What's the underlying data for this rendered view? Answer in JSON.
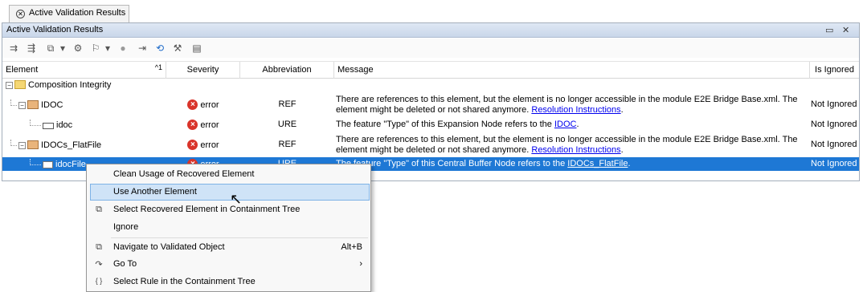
{
  "tab": {
    "label": "Active Validation Results"
  },
  "panel": {
    "title": "Active Validation Results",
    "restore_glyph": "▭",
    "close_glyph": "✕"
  },
  "toolbar": {
    "icons": [
      "⇉",
      "⇶",
      "⧉",
      "▾",
      "⚙",
      "⚐",
      "▾",
      "●",
      "⇥",
      "⟲",
      "⚒",
      "▤"
    ]
  },
  "table": {
    "headers": {
      "element": "Element",
      "sort": "^1",
      "severity": "Severity",
      "abbreviation": "Abbreviation",
      "message": "Message",
      "ignored": "Is Ignored"
    },
    "group": {
      "label": "Composition Integrity"
    },
    "rows": [
      {
        "element": "IDOC",
        "severity": "error",
        "abbr": "REF",
        "msg1": "There are references to this element, but the element is no longer accessible in the module E2E Bridge Base.xml. The",
        "msg2": "element might be deleted or not shared anymore. ",
        "link": "Resolution Instructions",
        "tail": ".",
        "ignored": "Not Ignored"
      },
      {
        "element": "idoc",
        "severity": "error",
        "abbr": "URE",
        "msg1": "The feature \"Type\" of this Expansion Node refers to the ",
        "link": "IDOC",
        "tail": ".",
        "ignored": "Not Ignored"
      },
      {
        "element": "IDOCs_FlatFile",
        "severity": "error",
        "abbr": "REF",
        "msg1": "There are references to this element, but the element is no longer accessible in the module E2E Bridge Base.xml. The",
        "msg2": "element might be deleted or not shared anymore. ",
        "link": "Resolution Instructions",
        "tail": ".",
        "ignored": "Not Ignored"
      },
      {
        "element": "idocFile",
        "severity": "error",
        "abbr": "URE",
        "msg1": "The feature \"Type\" of this Central Buffer Node refers to the ",
        "link": "IDOCs_FlatFile",
        "tail": ".",
        "ignored": "Not Ignored"
      }
    ]
  },
  "context_menu": {
    "items": [
      {
        "label": "Clean Usage of Recovered Element"
      },
      {
        "label": "Use Another Element"
      },
      {
        "label": "Select Recovered Element in Containment Tree",
        "icon": "⧉"
      },
      {
        "label": "Ignore"
      },
      {
        "label": "Navigate to Validated Object",
        "icon": "⧉",
        "shortcut": "Alt+B"
      },
      {
        "label": "Go To",
        "icon": "↷",
        "submenu": "›"
      },
      {
        "label": "Select Rule in the Containment Tree",
        "icon": "{ }"
      }
    ]
  },
  "colors": {
    "selection": "#1e78d5",
    "error": "#d9342a",
    "link": "#0000ee"
  }
}
